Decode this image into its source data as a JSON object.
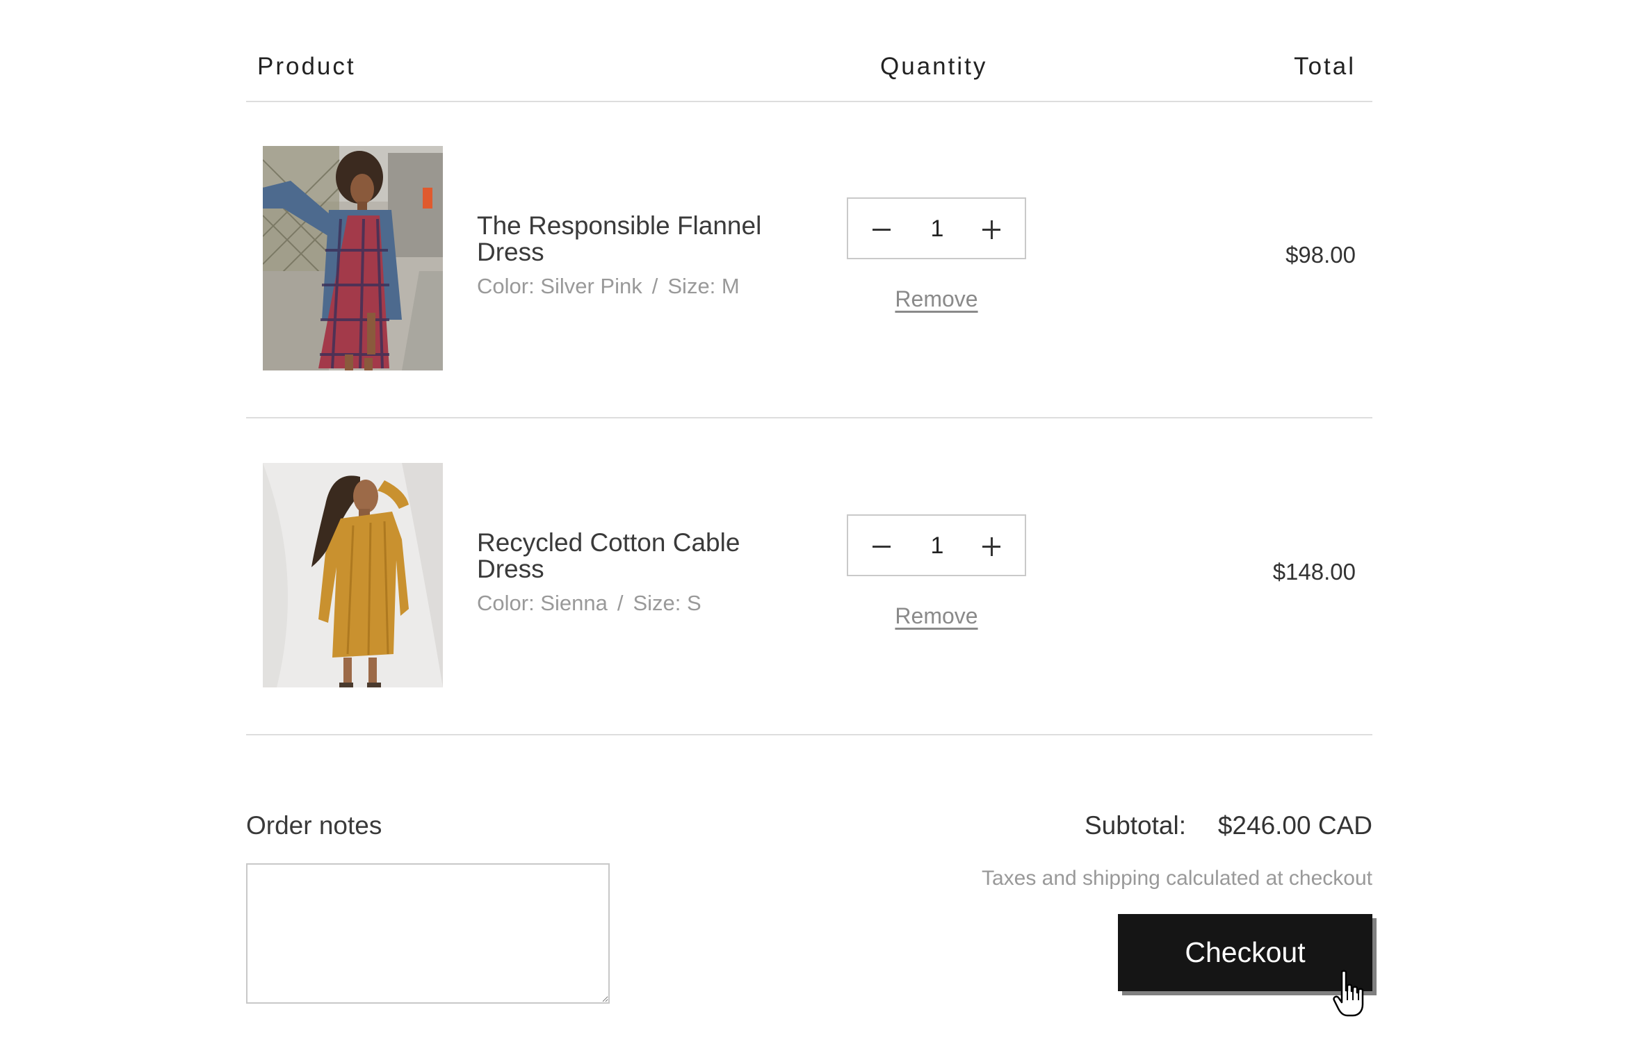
{
  "table_header": {
    "product": "Product",
    "quantity": "Quantity",
    "total": "Total"
  },
  "items": [
    {
      "name": "The Responsible Flannel Dress",
      "color": "Color: Silver Pink",
      "separator": "/",
      "size": "Size: M",
      "quantity": "1",
      "remove_label": "Remove",
      "price": "$98.00"
    },
    {
      "name": "Recycled Cotton Cable Dress",
      "color": "Color: Sienna",
      "separator": "/",
      "size": "Size: S",
      "quantity": "1",
      "remove_label": "Remove",
      "price": "$148.00"
    }
  ],
  "order_notes": {
    "label": "Order notes",
    "value": ""
  },
  "summary": {
    "subtotal_label": "Subtotal:",
    "subtotal_value": "$246.00 CAD",
    "tax_note": "Taxes and shipping calculated at checkout",
    "checkout_label": "Checkout"
  },
  "icons": {
    "decrement": "minus-icon",
    "increment": "plus-icon",
    "cursor": "hand-pointer-icon"
  },
  "colors": {
    "checkout_bg": "#151515",
    "checkout_shadow": "#808080",
    "muted_text": "#999999",
    "divider": "#dddddd"
  }
}
